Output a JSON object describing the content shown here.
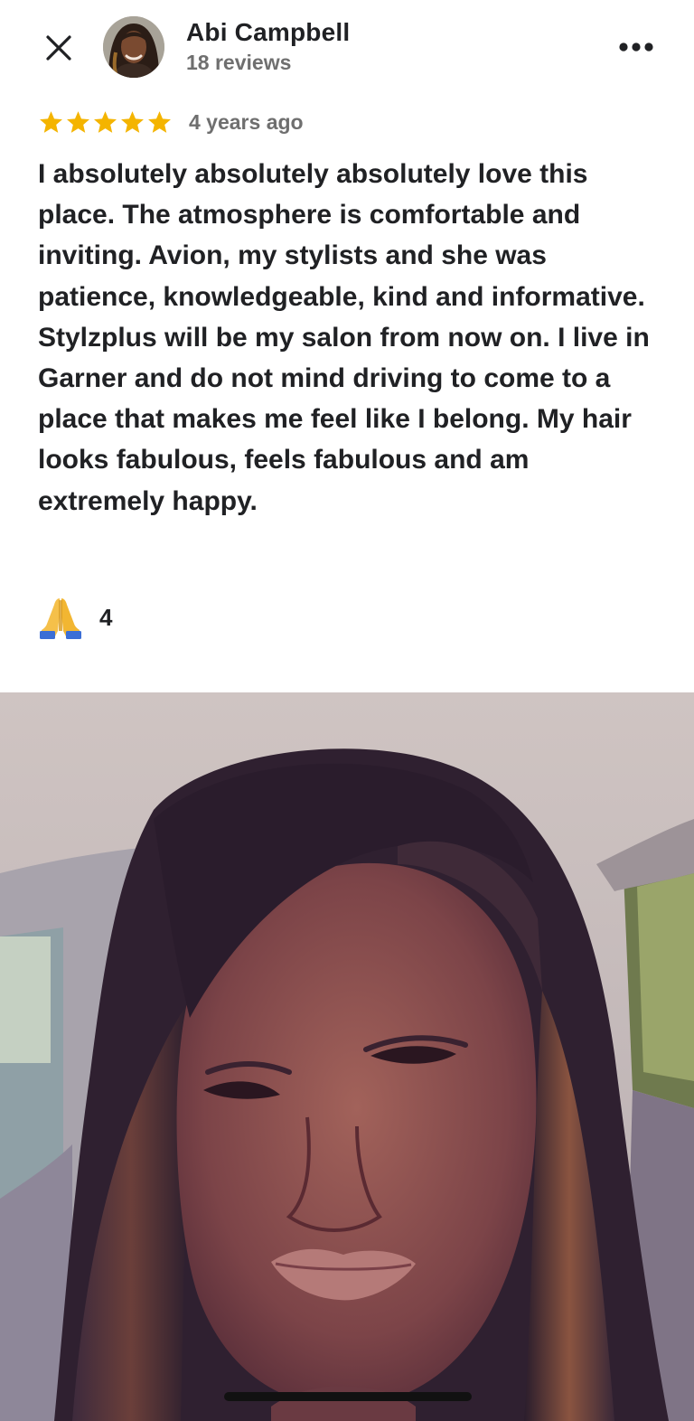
{
  "review": {
    "author": {
      "name": "Abi Campbell",
      "reviews_count": "18 reviews"
    },
    "rating": 5,
    "rating_max": 5,
    "time_ago": "4 years ago",
    "text": "I absolutely absolutely absolutely love this place. The atmosphere is comfortable and inviting. Avion, my stylists and she was patience, knowledgeable, kind and informative. Stylzplus will be my salon from now on. I live in Garner and do not mind driving to come to a place that makes me feel like I belong. My hair looks fabulous, feels fabulous and am extremely happy.",
    "reaction": {
      "emoji": "🙏",
      "count": "4"
    }
  },
  "icons": {
    "close": "close-icon",
    "more": "more-horizontal-icon",
    "star": "star-icon",
    "reaction": "folded-hands-icon"
  },
  "colors": {
    "star": "#F4B400",
    "text_primary": "#202124",
    "text_secondary": "#6F6F6F"
  }
}
